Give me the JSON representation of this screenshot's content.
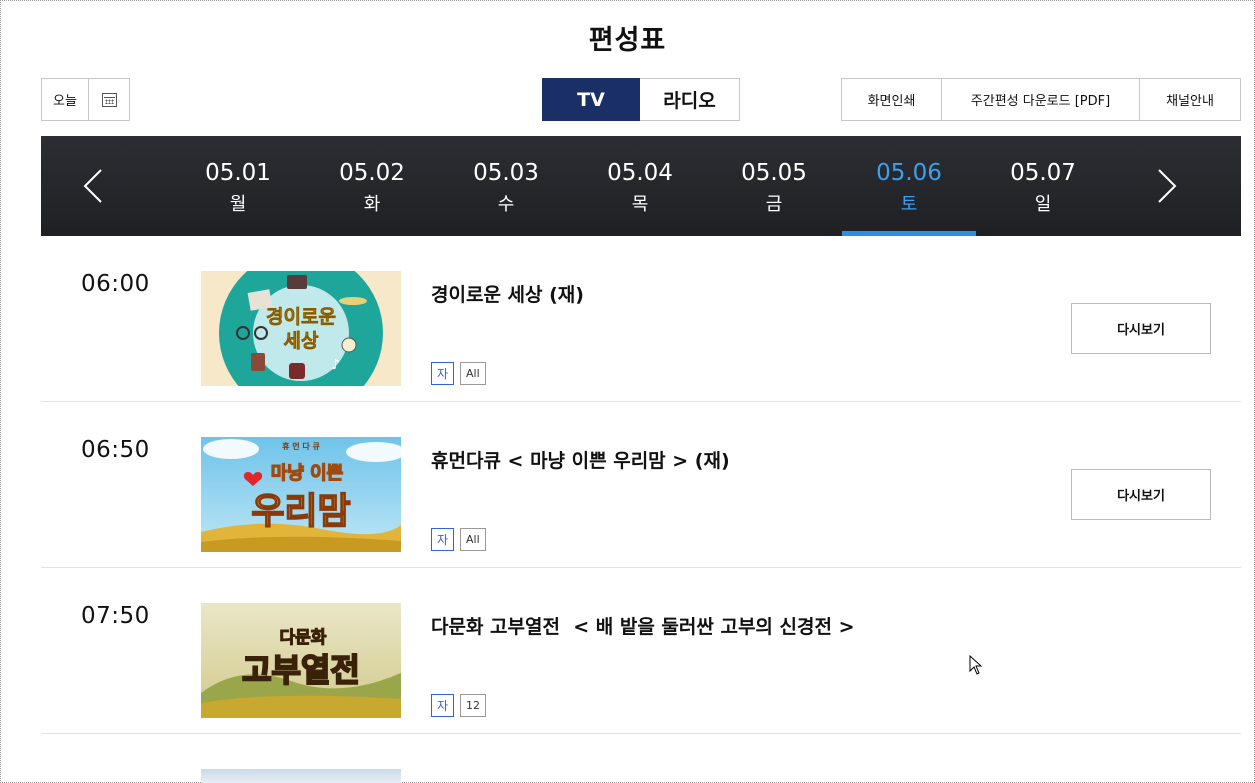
{
  "page_title": "편성표",
  "today_label": "오늘",
  "media_tabs": [
    {
      "label": "TV",
      "active": true
    },
    {
      "label": "라디오",
      "active": false
    }
  ],
  "utilities": [
    "화면인쇄",
    "주간편성 다운로드 [PDF]",
    "채널안내"
  ],
  "dates": [
    {
      "date": "05.01",
      "day": "월"
    },
    {
      "date": "05.02",
      "day": "화"
    },
    {
      "date": "05.03",
      "day": "수"
    },
    {
      "date": "05.04",
      "day": "목"
    },
    {
      "date": "05.05",
      "day": "금"
    },
    {
      "date": "05.06",
      "day": "토",
      "active": true
    },
    {
      "date": "05.07",
      "day": "일"
    }
  ],
  "programs": [
    {
      "time": "06:00",
      "title": "경이로운 세상 (재)",
      "cc": "자",
      "rating": "All",
      "replay_label": "다시보기",
      "thumb_text": [
        "경이로운",
        "세상"
      ]
    },
    {
      "time": "06:50",
      "title": "휴먼다큐 < 마냥 이쁜 우리맘 > (재)",
      "cc": "자",
      "rating": "All",
      "replay_label": "다시보기",
      "thumb_text": [
        "휴 먼 다 큐",
        "마냥 이쁜",
        "우리맘"
      ]
    },
    {
      "time": "07:50",
      "title": "다문화 고부열전  < 배 밭을 둘러싼 고부의 신경전 >",
      "cc": "자",
      "rating": "12",
      "thumb_text": [
        "다문화",
        "고부열전"
      ]
    }
  ],
  "colors": {
    "active_tab": "#1a2f66",
    "active_date": "#3aa1f0",
    "cc_badge": "#2f63d8",
    "date_strip": "#2c2e33"
  }
}
